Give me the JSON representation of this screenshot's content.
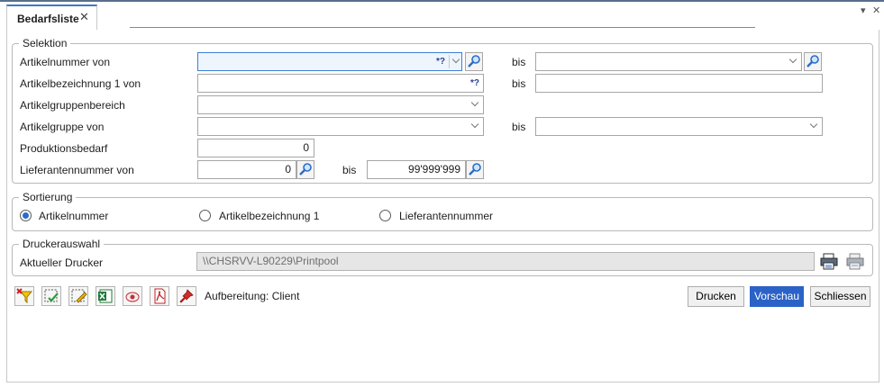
{
  "tab": {
    "title": "Bedarfsliste",
    "close": "✕"
  },
  "window_controls": {
    "menu": "▾",
    "close": "✕"
  },
  "selektion": {
    "legend": "Selektion",
    "artikelnummer_label": "Artikelnummer von",
    "artikelnummer_wildcard": "*?",
    "artikelbezeichnung_label": "Artikelbezeichnung 1 von",
    "artikelbezeichnung_wildcard": "*?",
    "artikelgruppenbereich_label": "Artikelgruppenbereich",
    "artikelgruppe_label": "Artikelgruppe von",
    "produktionsbedarf_label": "Produktionsbedarf",
    "produktionsbedarf_value": "0",
    "lieferantennummer_label": "Lieferantennummer von",
    "lieferant_von_value": "0",
    "lieferant_bis_value": "99'999'999",
    "bis": "bis"
  },
  "sortierung": {
    "legend": "Sortierung",
    "options": [
      "Artikelnummer",
      "Artikelbezeichnung 1",
      "Lieferantennummer"
    ],
    "selected": "Artikelnummer"
  },
  "drucker": {
    "legend": "Druckerauswahl",
    "label": "Aktueller Drucker",
    "value": "\\\\CHSRVV-L90229\\Printpool"
  },
  "footer": {
    "aufbereitung": "Aufbereitung: Client",
    "drucken": "Drucken",
    "vorschau": "Vorschau",
    "schliessen": "Schliessen"
  },
  "colors": {
    "accent": "#2b62c7",
    "border": "#a6a6a6"
  }
}
